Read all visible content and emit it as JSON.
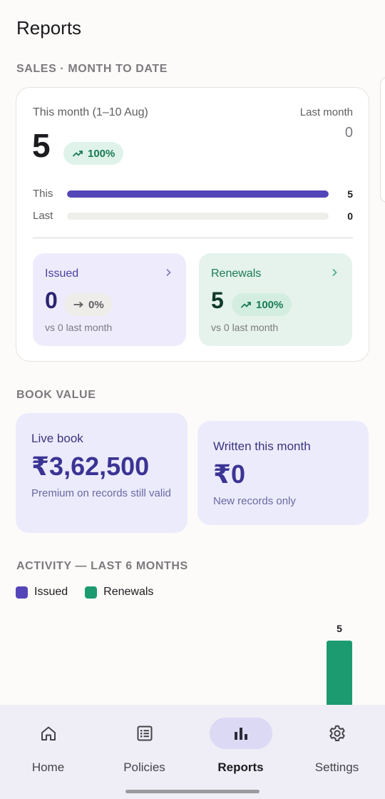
{
  "header": {
    "title": "Reports"
  },
  "sales": {
    "section_label": "SALES · MONTH TO DATE",
    "this_month_label": "This month (1–10 Aug)",
    "this_month_value": "5",
    "change_pill": "100%",
    "last_month_label": "Last month",
    "last_month_value": "0",
    "bars": [
      {
        "label": "This",
        "count": "5",
        "fraction": 1.0
      },
      {
        "label": "Last",
        "count": "0",
        "fraction": 0.0
      }
    ],
    "issued": {
      "title": "Issued",
      "value": "0",
      "change": "0%",
      "trend_icon": "arrow-right-icon",
      "sub": "vs 0 last month"
    },
    "renewals": {
      "title": "Renewals",
      "value": "5",
      "change": "100%",
      "trend_icon": "trending-up-icon",
      "sub": "vs 0 last month"
    }
  },
  "book_value": {
    "section_label": "BOOK VALUE",
    "live": {
      "label": "Live book",
      "value": "₹3,62,500",
      "note": "Premium on records still valid"
    },
    "written": {
      "label": "Written this month",
      "value": "₹0",
      "note": "New records only"
    }
  },
  "activity": {
    "section_label": "ACTIVITY — LAST 6 MONTHS",
    "legend": [
      {
        "label": "Issued",
        "color": "#5446b8"
      },
      {
        "label": "Renewals",
        "color": "#1d9b70"
      }
    ]
  },
  "chart_data": {
    "type": "bar",
    "title": "ACTIVITY — LAST 6 MONTHS",
    "categories": [
      "",
      "",
      "",
      "",
      "",
      ""
    ],
    "series": [
      {
        "name": "Issued",
        "values": [
          0,
          0,
          0,
          0,
          0,
          0
        ],
        "color": "#5446b8"
      },
      {
        "name": "Renewals",
        "values": [
          0,
          0,
          0,
          0,
          0,
          5
        ],
        "color": "#1d9b70"
      }
    ],
    "data_labels": [
      "5"
    ],
    "ylim": [
      0,
      5
    ]
  },
  "nav": {
    "items": [
      {
        "label": "Home",
        "icon": "home-icon",
        "active": false
      },
      {
        "label": "Policies",
        "icon": "list-icon",
        "active": false
      },
      {
        "label": "Reports",
        "icon": "bar-chart-icon",
        "active": true
      },
      {
        "label": "Settings",
        "icon": "gear-icon",
        "active": false
      }
    ]
  },
  "colors": {
    "accent": "#5446b8",
    "positive": "#1b7a55",
    "renewals_bar": "#1d9b70"
  }
}
